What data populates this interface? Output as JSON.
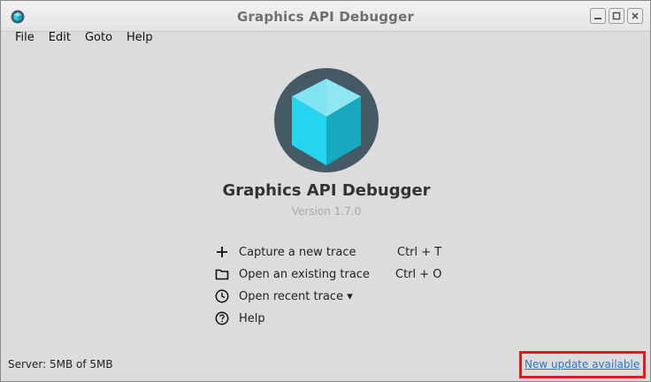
{
  "window": {
    "title": "Graphics API Debugger"
  },
  "menu": [
    "File",
    "Edit",
    "Goto",
    "Help"
  ],
  "welcome": {
    "app_name": "Graphics API Debugger",
    "version": "Version 1.7.0",
    "actions": [
      {
        "label": "Capture a new trace",
        "shortcut": "Ctrl + T",
        "icon": "plus-icon"
      },
      {
        "label": "Open an existing trace",
        "shortcut": "Ctrl + O",
        "icon": "folder-icon"
      },
      {
        "label": "Open recent trace ▾",
        "shortcut": "",
        "icon": "clock-icon"
      },
      {
        "label": "Help",
        "shortcut": "",
        "icon": "help-circle-icon"
      }
    ]
  },
  "status": {
    "server": "Server: 5MB of 5MB",
    "update_link": "New update available"
  },
  "colors": {
    "highlight_border": "#e8161c",
    "link": "#2a78c6",
    "cube_light": "#26d4ee",
    "cube_dark": "#18a8c0",
    "logo_bg": "#455a64"
  }
}
